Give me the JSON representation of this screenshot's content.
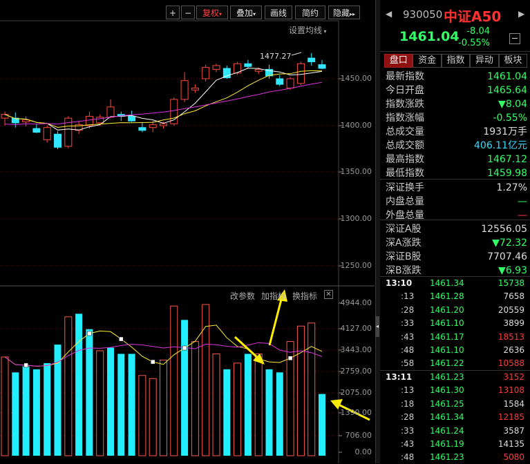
{
  "toolbar": {
    "plus": "+",
    "minus": "−",
    "fuquan": "复权",
    "diejia": "叠加",
    "huaxian": "画线",
    "jianyue": "简约",
    "yincang": "隐藏",
    "more": "▸▸"
  },
  "chart": {
    "ma_setting": "设置均线",
    "max_label": "1477.27",
    "price_ticks": [
      "1450.00",
      "1400.00",
      "1350.00",
      "1300.00",
      "1250.00"
    ],
    "volume_ticks": [
      "4944.00",
      "4127.00",
      "3443.00",
      "2759.00",
      "2075.00",
      "1390.00",
      "706.00",
      "0.00"
    ],
    "indicator_ctrls": [
      "改参数",
      "加指标",
      "换指标"
    ]
  },
  "chart_data": {
    "type": "candlestick",
    "y_range": [
      1225,
      1480
    ],
    "candles": [
      {
        "o": 1408,
        "h": 1415,
        "l": 1400,
        "c": 1412
      },
      {
        "o": 1408,
        "h": 1414,
        "l": 1398,
        "c": 1403
      },
      {
        "o": 1404,
        "h": 1410,
        "l": 1399,
        "c": 1406
      },
      {
        "o": 1397,
        "h": 1402,
        "l": 1392,
        "c": 1393
      },
      {
        "o": 1385,
        "h": 1400,
        "l": 1382,
        "c": 1398
      },
      {
        "o": 1391,
        "h": 1394,
        "l": 1375,
        "c": 1377
      },
      {
        "o": 1378,
        "h": 1410,
        "l": 1376,
        "c": 1408
      },
      {
        "o": 1395,
        "h": 1405,
        "l": 1391,
        "c": 1401
      },
      {
        "o": 1400,
        "h": 1415,
        "l": 1397,
        "c": 1410
      },
      {
        "o": 1403,
        "h": 1412,
        "l": 1400,
        "c": 1409
      },
      {
        "o": 1409,
        "h": 1428,
        "l": 1408,
        "c": 1420
      },
      {
        "o": 1412,
        "h": 1415,
        "l": 1405,
        "c": 1410
      },
      {
        "o": 1410,
        "h": 1416,
        "l": 1404,
        "c": 1405
      },
      {
        "o": 1398,
        "h": 1403,
        "l": 1393,
        "c": 1395
      },
      {
        "o": 1398,
        "h": 1405,
        "l": 1393,
        "c": 1401
      },
      {
        "o": 1400,
        "h": 1404,
        "l": 1397,
        "c": 1402
      },
      {
        "o": 1402,
        "h": 1430,
        "l": 1400,
        "c": 1428
      },
      {
        "o": 1428,
        "h": 1457,
        "l": 1425,
        "c": 1448
      },
      {
        "o": 1438,
        "h": 1444,
        "l": 1435,
        "c": 1440
      },
      {
        "o": 1450,
        "h": 1465,
        "l": 1447,
        "c": 1462
      },
      {
        "o": 1460,
        "h": 1466,
        "l": 1457,
        "c": 1464
      },
      {
        "o": 1461,
        "h": 1464,
        "l": 1450,
        "c": 1451
      },
      {
        "o": 1456,
        "h": 1468,
        "l": 1454,
        "c": 1466
      },
      {
        "o": 1466,
        "h": 1470,
        "l": 1461,
        "c": 1463
      },
      {
        "o": 1458,
        "h": 1462,
        "l": 1455,
        "c": 1460
      },
      {
        "o": 1460,
        "h": 1465,
        "l": 1450,
        "c": 1453
      },
      {
        "o": 1450,
        "h": 1454,
        "l": 1442,
        "c": 1444
      },
      {
        "o": 1440,
        "h": 1452,
        "l": 1438,
        "c": 1450
      },
      {
        "o": 1445,
        "h": 1468,
        "l": 1443,
        "c": 1466
      },
      {
        "o": 1472,
        "h": 1477.27,
        "l": 1464,
        "c": 1468
      },
      {
        "o": 1465,
        "h": 1470,
        "l": 1459.98,
        "c": 1461.04
      }
    ],
    "volume_range": [
      0,
      5100
    ],
    "volumes": [
      3200,
      2700,
      2900,
      2800,
      3000,
      3600,
      4500,
      4600,
      4100,
      3400,
      3500,
      3300,
      3300,
      2600,
      2500,
      3100,
      4850,
      4400,
      3700,
      4900,
      3300,
      2800,
      3000,
      3300,
      3300,
      2800,
      2700,
      3700,
      4200,
      4300,
      2000
    ],
    "volume_up": [
      true,
      false,
      false,
      false,
      false,
      false,
      true,
      false,
      false,
      true,
      false,
      false,
      false,
      true,
      true,
      true,
      true,
      false,
      true,
      true,
      true,
      false,
      true,
      false,
      true,
      false,
      false,
      true,
      true,
      true,
      false
    ]
  },
  "panel": {
    "code": "930050",
    "name": "中证A50",
    "price": "1461.04",
    "change": "-8.04",
    "change_pct": "-0.55%",
    "tabs": [
      "盘口",
      "资金",
      "指数",
      "异动",
      "板块"
    ],
    "rows": [
      {
        "label": "最新指数",
        "value": "1461.04",
        "color": "g"
      },
      {
        "label": "今日开盘",
        "value": "1465.64",
        "color": "g"
      },
      {
        "label": "指数涨跌",
        "value": "▼8.04",
        "color": "g"
      },
      {
        "label": "指数涨幅",
        "value": "-0.55%",
        "color": "g"
      },
      {
        "label": "总成交量",
        "value": "1931万手",
        "color": "w"
      },
      {
        "label": "总成交额",
        "value": "406.11亿元",
        "color": "c"
      },
      {
        "label": "最高指数",
        "value": "1467.12",
        "color": "g"
      },
      {
        "label": "最低指数",
        "value": "1459.98",
        "color": "g"
      },
      {
        "label": "深证换手",
        "value": "1.27%",
        "color": "w"
      },
      {
        "label": "内盘总量",
        "value": "—",
        "color": "g"
      },
      {
        "label": "外盘总量",
        "value": "—",
        "color": "r"
      },
      {
        "label": "深证A股",
        "value": "12556.05",
        "color": "w"
      },
      {
        "label": "深A涨跌",
        "value": "▼72.32",
        "color": "g"
      },
      {
        "label": "深证B股",
        "value": "7707.46",
        "color": "w"
      },
      {
        "label": "深B涨跌",
        "value": "▼6.93",
        "color": "g"
      }
    ],
    "ticks_1": {
      "head": "13:10",
      "items": [
        {
          "t": "13:10",
          "p": "1461.34",
          "v": "15738",
          "vc": "g"
        },
        {
          "t": ":13",
          "p": "1461.28",
          "v": "7658",
          "vc": "w"
        },
        {
          "t": ":28",
          "p": "1461.20",
          "v": "20559",
          "vc": "w"
        },
        {
          "t": ":33",
          "p": "1461.10",
          "v": "3899",
          "vc": "w"
        },
        {
          "t": ":43",
          "p": "1461.17",
          "v": "18513",
          "vc": "r"
        },
        {
          "t": ":48",
          "p": "1461.10",
          "v": "2636",
          "vc": "w"
        },
        {
          "t": ":58",
          "p": "1461.22",
          "v": "10588",
          "vc": "r"
        }
      ]
    },
    "ticks_2": {
      "items": [
        {
          "t": "13:11",
          "p": "1461.23",
          "v": "3152",
          "vc": "r"
        },
        {
          "t": ":13",
          "p": "1461.30",
          "v": "13108",
          "vc": "r"
        },
        {
          "t": ":18",
          "p": "1461.25",
          "v": "1584",
          "vc": "w"
        },
        {
          "t": ":28",
          "p": "1461.34",
          "v": "12185",
          "vc": "r"
        },
        {
          "t": ":33",
          "p": "1461.24",
          "v": "3587",
          "vc": "w"
        },
        {
          "t": ":43",
          "p": "1461.19",
          "v": "14135",
          "vc": "w"
        },
        {
          "t": ":48",
          "p": "1461.23",
          "v": "5080",
          "vc": "r"
        }
      ]
    }
  }
}
